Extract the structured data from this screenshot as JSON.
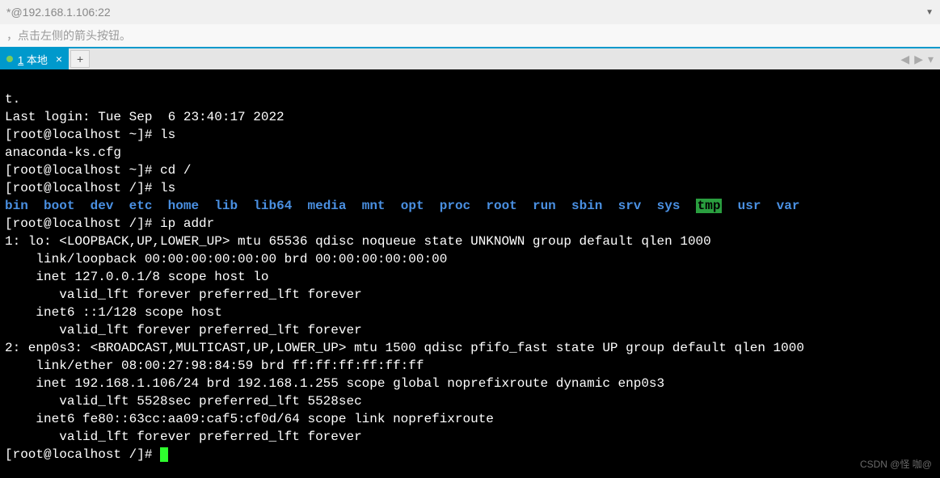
{
  "titlebar": {
    "text": "*@192.168.1.106:22"
  },
  "hintbar": {
    "text": "，点击左侧的箭头按钮。"
  },
  "tabs": {
    "active": {
      "num": "1",
      "label": "本地"
    },
    "add": "+"
  },
  "terminal": {
    "lines": {
      "l0": "t.",
      "l1": "Last login: Tue Sep  6 23:40:17 2022",
      "p1_prompt": "[root@localhost ~]# ",
      "p1_cmd": "ls",
      "l3": "anaconda-ks.cfg",
      "p2_prompt": "[root@localhost ~]# ",
      "p2_cmd": "cd /",
      "p3_prompt": "[root@localhost /]# ",
      "p3_cmd": "ls",
      "dirs": [
        "bin",
        "boot",
        "dev",
        "etc",
        "home",
        "lib",
        "lib64",
        "media",
        "mnt",
        "opt",
        "proc",
        "root",
        "run",
        "sbin",
        "srv",
        "sys",
        "tmp",
        "usr",
        "var"
      ],
      "p4_prompt": "[root@localhost /]# ",
      "p4_cmd": "ip addr",
      "ip1": "1: lo: <LOOPBACK,UP,LOWER_UP> mtu 65536 qdisc noqueue state UNKNOWN group default qlen 1000",
      "ip2": "    link/loopback 00:00:00:00:00:00 brd 00:00:00:00:00:00",
      "ip3": "    inet 127.0.0.1/8 scope host lo",
      "ip4": "       valid_lft forever preferred_lft forever",
      "ip5": "    inet6 ::1/128 scope host",
      "ip6": "       valid_lft forever preferred_lft forever",
      "ip7": "2: enp0s3: <BROADCAST,MULTICAST,UP,LOWER_UP> mtu 1500 qdisc pfifo_fast state UP group default qlen 1000",
      "ip8": "    link/ether 08:00:27:98:84:59 brd ff:ff:ff:ff:ff:ff",
      "ip9": "    inet 192.168.1.106/24 brd 192.168.1.255 scope global noprefixroute dynamic enp0s3",
      "ip10": "       valid_lft 5528sec preferred_lft 5528sec",
      "ip11": "    inet6 fe80::63cc:aa09:caf5:cf0d/64 scope link noprefixroute",
      "ip12": "       valid_lft forever preferred_lft forever",
      "p5_prompt": "[root@localhost /]# "
    }
  },
  "watermark": "CSDN @怪 咖@"
}
